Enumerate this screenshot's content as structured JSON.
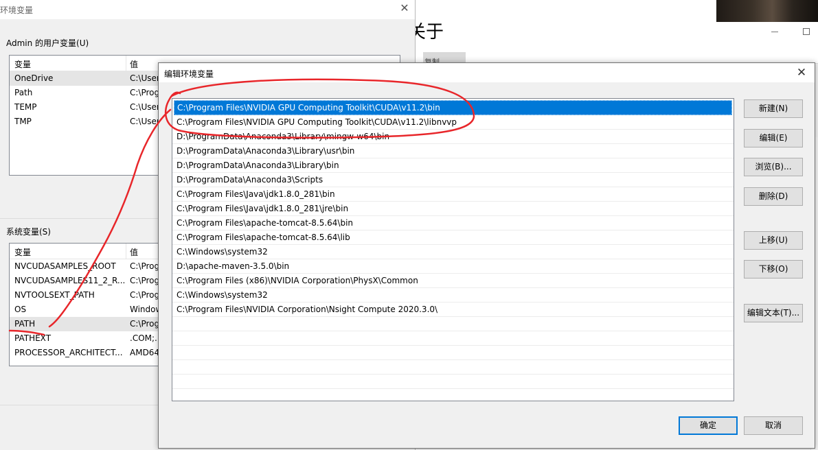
{
  "about_window": {
    "title": "关于",
    "copy_tab": "复制"
  },
  "env_window": {
    "title": "环境变量",
    "user_group_label": "Admin 的用户变量(U)",
    "user_table": {
      "headers": [
        "变量",
        "值"
      ],
      "rows": [
        {
          "name": "OneDrive",
          "value": "C:\\User"
        },
        {
          "name": "Path",
          "value": "C:\\Prog"
        },
        {
          "name": "TEMP",
          "value": "C:\\User"
        },
        {
          "name": "TMP",
          "value": "C:\\User"
        }
      ]
    },
    "system_group_label": "系统变量(S)",
    "system_table": {
      "headers": [
        "变量",
        "值"
      ],
      "rows": [
        {
          "name": "NVCUDASAMPLES_ROOT",
          "value": "C:\\Prog"
        },
        {
          "name": "NVCUDASAMPLES11_2_R...",
          "value": "C:\\Prog"
        },
        {
          "name": "NVTOOLSEXT_PATH",
          "value": "C:\\Prog"
        },
        {
          "name": "OS",
          "value": "Window"
        },
        {
          "name": "PATH",
          "value": "C:\\Prog"
        },
        {
          "name": "PATHEXT",
          "value": ".COM;.E"
        },
        {
          "name": "PROCESSOR_ARCHITECT...",
          "value": "AMD64"
        }
      ]
    }
  },
  "edit_dialog": {
    "title": "编辑环境变量",
    "paths": [
      "C:\\Program Files\\NVIDIA GPU Computing Toolkit\\CUDA\\v11.2\\bin",
      "C:\\Program Files\\NVIDIA GPU Computing Toolkit\\CUDA\\v11.2\\libnvvp",
      "D:\\ProgramData\\Anaconda3\\Library\\mingw-w64\\bin",
      "D:\\ProgramData\\Anaconda3\\Library\\usr\\bin",
      "D:\\ProgramData\\Anaconda3\\Library\\bin",
      "D:\\ProgramData\\Anaconda3\\Scripts",
      "C:\\Program Files\\Java\\jdk1.8.0_281\\bin",
      "C:\\Program Files\\Java\\jdk1.8.0_281\\jre\\bin",
      "C:\\Program Files\\apache-tomcat-8.5.64\\bin",
      "C:\\Program Files\\apache-tomcat-8.5.64\\lib",
      "C:\\Windows\\system32",
      "D:\\apache-maven-3.5.0\\bin",
      "C:\\Program Files (x86)\\NVIDIA Corporation\\PhysX\\Common",
      "C:\\Windows\\system32",
      "C:\\Program Files\\NVIDIA Corporation\\Nsight Compute 2020.3.0\\"
    ],
    "buttons": {
      "new": "新建(N)",
      "edit": "编辑(E)",
      "browse": "浏览(B)...",
      "delete": "删除(D)",
      "move_up": "上移(U)",
      "move_down": "下移(O)",
      "edit_text": "编辑文本(T)...",
      "ok": "确定",
      "cancel": "取消"
    }
  },
  "colors": {
    "selection": "#0078d7",
    "annotation": "#e8262a"
  }
}
